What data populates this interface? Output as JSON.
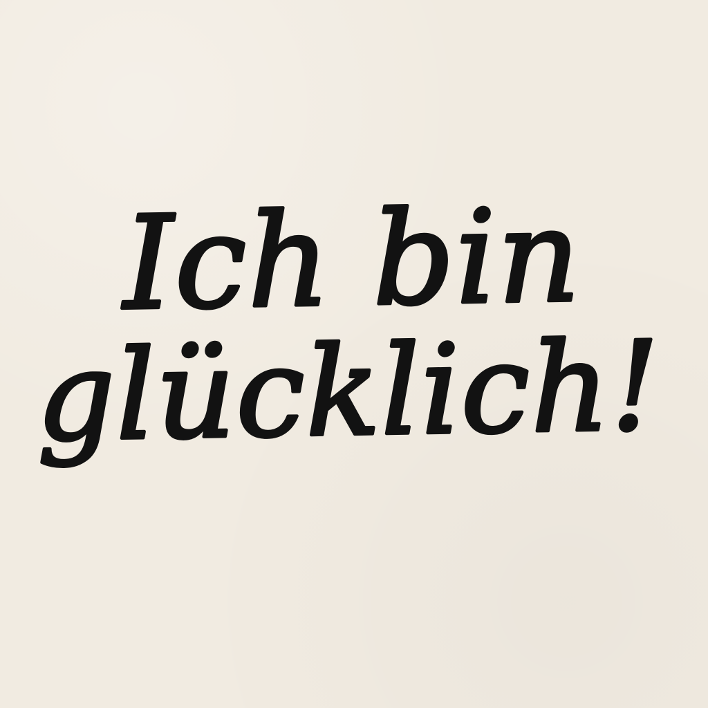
{
  "note": {
    "lines": [
      "Ich bin",
      "glücklich!"
    ]
  },
  "colors": {
    "paper": "#f1ebe1",
    "ink": "#121212"
  }
}
